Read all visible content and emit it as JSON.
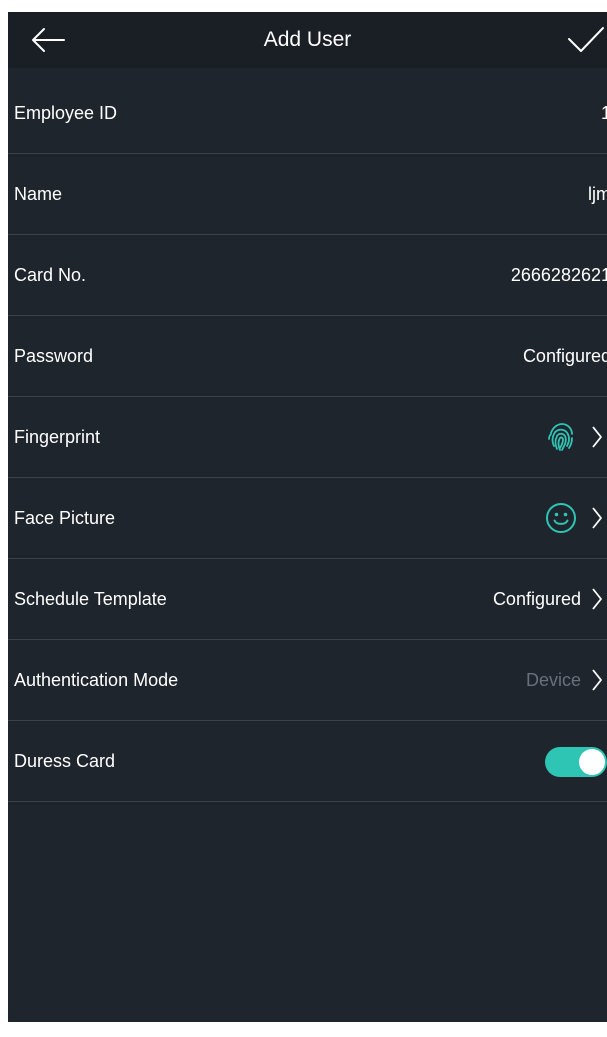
{
  "header": {
    "title": "Add User",
    "back_icon": "arrow-left-icon",
    "confirm_icon": "checkmark-icon"
  },
  "colors": {
    "background": "#1f252d",
    "header": "#1a1f26",
    "accent": "#2ec5b5",
    "muted_text": "#6a707a",
    "divider": "#3a414a"
  },
  "rows": [
    {
      "label": "Employee ID",
      "value": "1"
    },
    {
      "label": "Name",
      "value": "ljm"
    },
    {
      "label": "Card No.",
      "value": "2666282621"
    },
    {
      "label": "Password",
      "value": "Configured"
    },
    {
      "label": "Fingerprint",
      "icon": "fingerprint-icon"
    },
    {
      "label": "Face Picture",
      "icon": "smiley-face-icon"
    },
    {
      "label": "Schedule Template",
      "value": "Configured"
    },
    {
      "label": "Authentication Mode",
      "value": "Device"
    },
    {
      "label": "Duress Card",
      "toggle": true
    }
  ]
}
